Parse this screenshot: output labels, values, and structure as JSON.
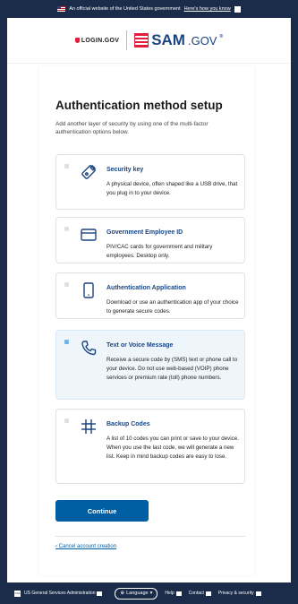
{
  "banner": {
    "text": "An official website of the United States government",
    "link": "Here's how you know"
  },
  "header": {
    "login_logo": "LOGIN.GOV",
    "sam_logo_main": "SAM",
    "sam_logo_suffix": ".GOV",
    "sam_logo_mark": "®"
  },
  "main": {
    "title": "Authentication method setup",
    "subtitle": "Add another layer of security by using one of the multi-factor authentication options below.",
    "options": [
      {
        "title": "Security key",
        "desc": "A physical device, often shaped like a USB drive, that you plug in to your device.",
        "icon": "security-key-icon",
        "selected": false
      },
      {
        "title": "Government Employee ID",
        "desc": "PIV/CAC cards for government and military employees. Desktop only.",
        "icon": "id-card-icon",
        "selected": false
      },
      {
        "title": "Authentication Application",
        "desc": "Download or use an authentication app of your choice to generate secure codes.",
        "icon": "phone-app-icon",
        "selected": false
      },
      {
        "title": "Text or Voice Message",
        "desc": "Receive a secure code by (SMS) text or phone call to your device. Do not use web-based (VOIP) phone services or premium rate (toll) phone numbers.",
        "icon": "phone-call-icon",
        "selected": true
      },
      {
        "title": "Backup Codes",
        "desc": "A list of 10 codes you can print or save to your device. When you use the last code, we will generate a new list. Keep in mind backup codes are easy to lose.",
        "icon": "backup-codes-icon",
        "selected": false
      }
    ],
    "continue_label": "Continue",
    "cancel_label": "‹ Cancel account creation"
  },
  "footer": {
    "gsa_logo": "GSA",
    "agency": "US General Services Administration",
    "language": "Language",
    "help": "Help",
    "contact": "Contact",
    "privacy": "Privacy & security"
  },
  "colors": {
    "navy": "#1b2b4a",
    "primary": "#005ea2",
    "heading_blue": "#1a4480",
    "selected_bg": "#eff6fb"
  }
}
